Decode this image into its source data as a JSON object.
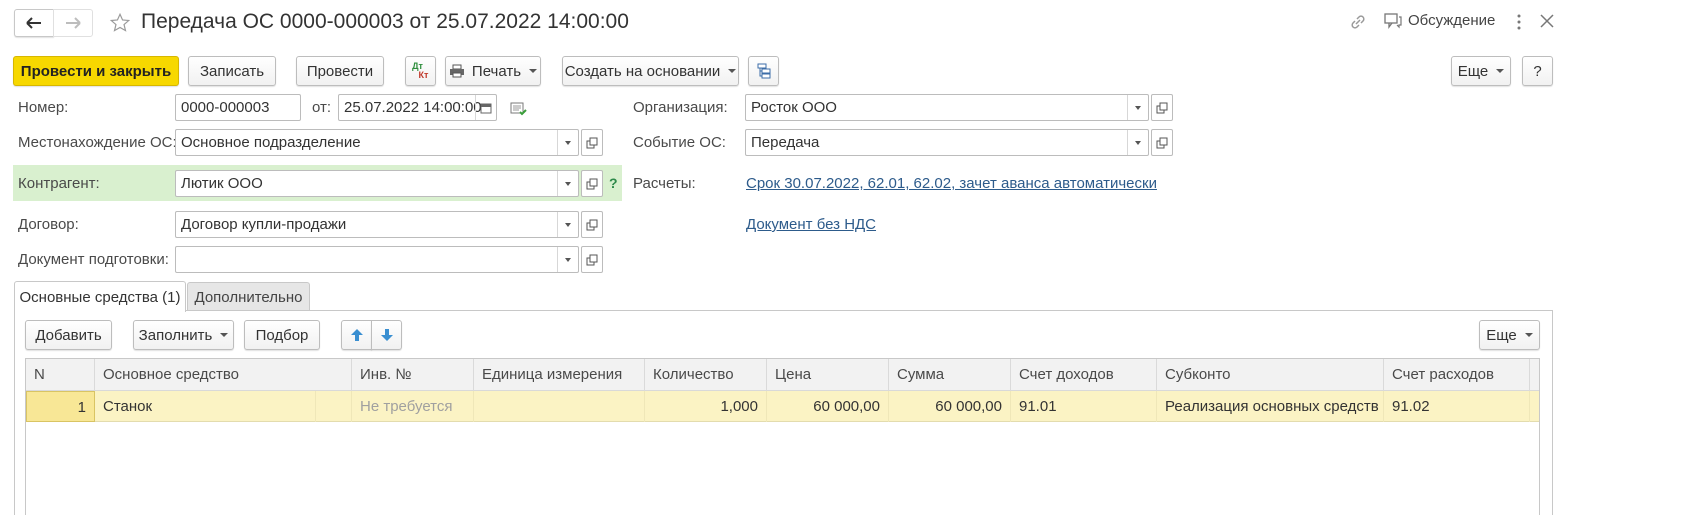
{
  "window": {
    "title": "Передача ОС 0000-000003 от 25.07.2022 14:00:00",
    "discussion_label": "Обсуждение"
  },
  "toolbar": {
    "post_close": "Провести и закрыть",
    "save": "Записать",
    "post": "Провести",
    "dt_kt_top": "Дт",
    "dt_kt_bottom": "Кт",
    "print": "Печать",
    "create_based": "Создать на основании",
    "more": "Еще",
    "help": "?"
  },
  "form": {
    "number_label": "Номер:",
    "number_value": "0000-000003",
    "date_label": "от:",
    "date_value": "25.07.2022 14:00:00",
    "location_label": "Местонахождение ОС:",
    "location_value": "Основное подразделение",
    "contractor_label": "Контрагент:",
    "contractor_value": "Лютик ООО",
    "contractor_hint": "?",
    "contract_label": "Договор:",
    "contract_value": "Договор купли-продажи",
    "prep_doc_label": "Документ подготовки:",
    "prep_doc_value": "",
    "org_label": "Организация:",
    "org_value": "Росток ООО",
    "event_label": "Событие ОС:",
    "event_value": "Передача",
    "settlements_label": "Расчеты:",
    "settlements_link": "Срок 30.07.2022, 62.01, 62.02, зачет аванса автоматически",
    "vat_link": "Документ без НДС"
  },
  "tabs": [
    {
      "label": "Основные средства (1)",
      "active": true
    },
    {
      "label": "Дополнительно",
      "active": false
    }
  ],
  "table_toolbar": {
    "add": "Добавить",
    "fill": "Заполнить",
    "pick": "Подбор",
    "more": "Еще"
  },
  "table": {
    "columns": [
      "N",
      "Основное средство",
      "Инв. №",
      "Единица измерения",
      "Количество",
      "Цена",
      "Сумма",
      "Счет доходов",
      "Субконто",
      "Счет расходов"
    ],
    "rows": [
      {
        "n": "1",
        "asset": "Станок",
        "inv": "Не требуется",
        "unit": "",
        "qty": "1,000",
        "price": "60 000,00",
        "sum": "60 000,00",
        "income_account": "91.01",
        "subconto": "Реализация основных средств",
        "expense_account": "91.02"
      }
    ]
  },
  "colors": {
    "primary_button": "#f7d800",
    "highlight_row": "#fbf3c4",
    "contractor_highlight": "#d9f0cf",
    "link": "#2d5b8b"
  }
}
